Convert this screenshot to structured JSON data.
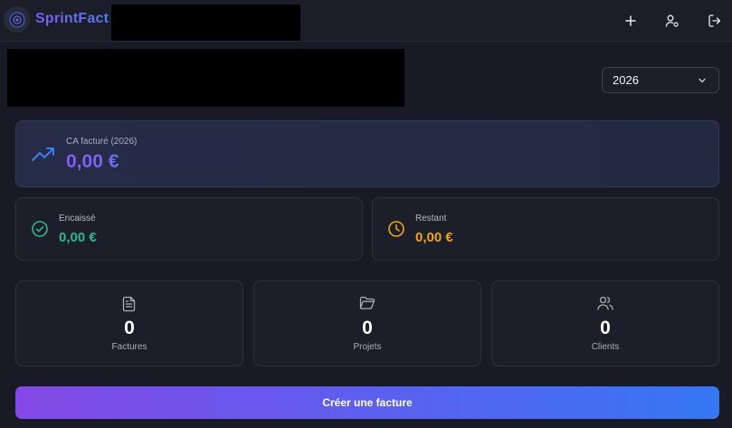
{
  "header": {
    "brand": "SprintFact",
    "icons": [
      "plus-icon",
      "user-settings-icon",
      "logout-icon"
    ]
  },
  "filters": {
    "year_selected": "2026"
  },
  "revenue": {
    "label": "CA facturé (2026)",
    "value": "0,00 €",
    "icon": "trending-up-icon"
  },
  "cashflow": {
    "cashed_label": "Encaissé",
    "cashed_value": "0,00 €",
    "remaining_label": "Restant",
    "remaining_value": "0,00 €"
  },
  "stats": [
    {
      "count": "0",
      "label": "Factures",
      "icon": "file-text-icon"
    },
    {
      "count": "0",
      "label": "Projets",
      "icon": "folder-icon"
    },
    {
      "count": "0",
      "label": "Clients",
      "icon": "users-icon"
    }
  ],
  "cta": {
    "label": "Créer une facture"
  },
  "colors": {
    "accent_purple": "#8448e6",
    "accent_blue": "#3577f2",
    "success": "#2fb889",
    "warning": "#f0a21c",
    "background": "#181b25"
  }
}
